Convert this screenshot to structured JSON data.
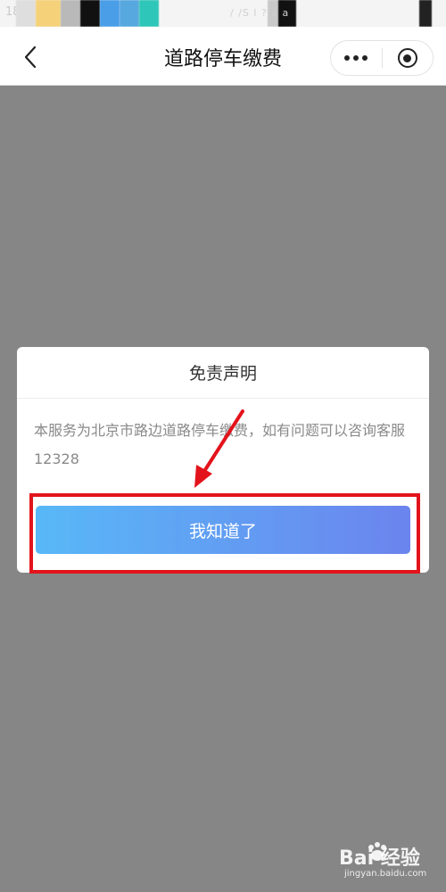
{
  "status_bar": {
    "left_text": "18",
    "right_text": "/ /S  l  ?  a  a"
  },
  "nav": {
    "title": "道路停车缴费",
    "back_icon": "chevron-left-icon",
    "more_icon": "more-dots-icon",
    "close_icon": "target-circle-icon"
  },
  "dialog": {
    "title": "免责声明",
    "body": "本服务为北京市路边道路停车缴费，如有问题可以咨询客服12328",
    "confirm_label": "我知道了"
  },
  "watermark": {
    "brand": "Bai 经验",
    "url": "jingyan.baidu.com"
  },
  "colors": {
    "overlay": "#868686",
    "button_start": "#58b8f7",
    "button_end": "#6b84ee",
    "annotation_red": "#e3131b"
  }
}
